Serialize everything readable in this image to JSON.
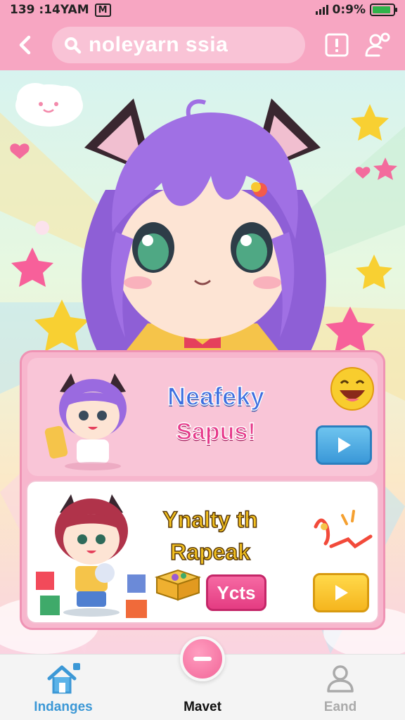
{
  "status_bar": {
    "time": "139 :14YAM",
    "carrier_badge": "M",
    "battery_text": "0:9%",
    "battery_level": 0.9
  },
  "top_bar": {
    "search_value": "noleyarn ssia",
    "icons": [
      "back-arrow-icon",
      "search-icon",
      "alert-icon",
      "user-settings-icon"
    ]
  },
  "cards": [
    {
      "title_line1": "Neafeky",
      "title_line2": "Sapus!",
      "play_color": "#3a98d8",
      "icons": [
        "chibi-cat-girl-purple",
        "laughing-emoji-icon",
        "play-icon"
      ]
    },
    {
      "title_line1": "Ynalty th",
      "title_line2": "Rapeak",
      "button_label": "Ycts",
      "play_color": "#f5b51e",
      "icons": [
        "chibi-cat-girl-red",
        "gift-box-icon",
        "rope-knot-icon",
        "play-icon"
      ]
    }
  ],
  "bottom_nav": {
    "items": [
      {
        "label": "Indanges",
        "icon": "home-icon",
        "active": true
      },
      {
        "label": "Mavet",
        "icon": "minus-icon",
        "active": false
      },
      {
        "label": "Eand",
        "icon": "profile-icon",
        "active": false
      }
    ]
  },
  "colors": {
    "accent_pink": "#f7a6c2",
    "active_blue": "#3c98d6",
    "inactive_gray": "#aaaaaa"
  }
}
